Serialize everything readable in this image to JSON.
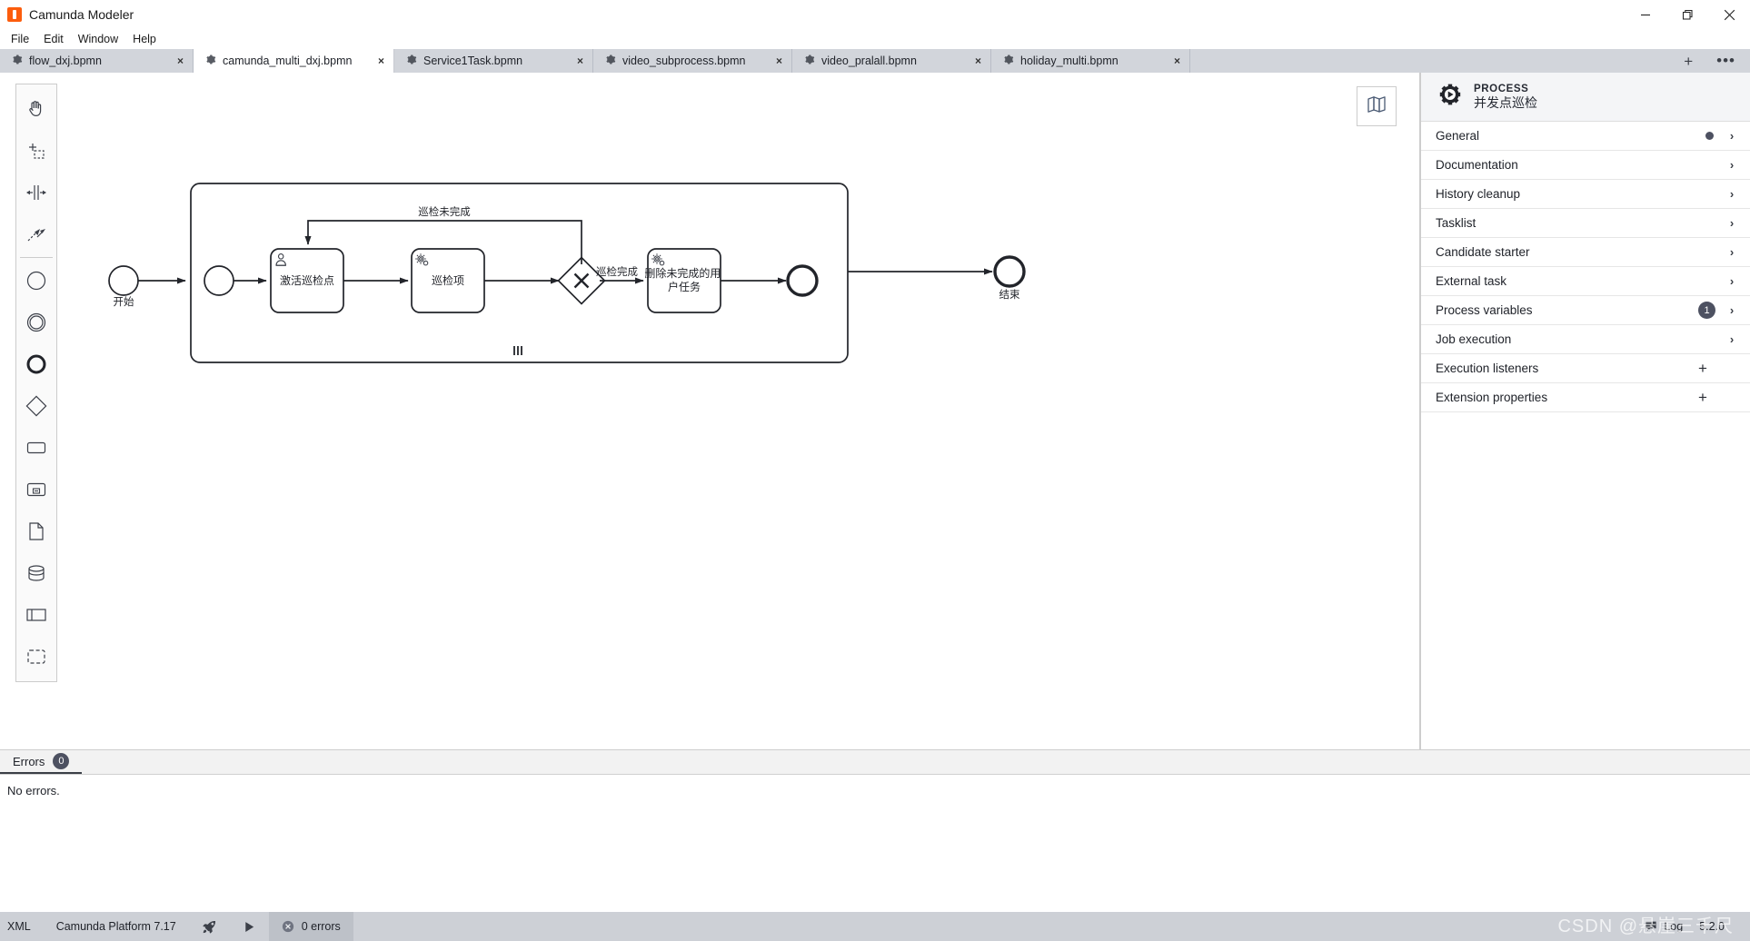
{
  "window": {
    "title": "Camunda Modeler",
    "app_icon": "camunda-icon",
    "minimize": "minimize-icon",
    "maximize": "maximize-icon",
    "close": "close-icon"
  },
  "menu": {
    "items": [
      {
        "label": "File"
      },
      {
        "label": "Edit"
      },
      {
        "label": "Window"
      },
      {
        "label": "Help"
      }
    ]
  },
  "tabs": {
    "items": [
      {
        "label": "flow_dxj.bpmn",
        "active": false,
        "close": "×"
      },
      {
        "label": "camunda_multi_dxj.bpmn",
        "active": true,
        "close": "×"
      },
      {
        "label": "Service1Task.bpmn",
        "active": false,
        "close": "×"
      },
      {
        "label": "video_subprocess.bpmn",
        "active": false,
        "close": "×"
      },
      {
        "label": "video_pralall.bpmn",
        "active": false,
        "close": "×"
      },
      {
        "label": "holiday_multi.bpmn",
        "active": false,
        "close": "×"
      }
    ],
    "new_tab_label": "+",
    "more_label": "•••"
  },
  "palette": {
    "tools": [
      {
        "name": "hand-tool-icon"
      },
      {
        "name": "lasso-tool-icon"
      },
      {
        "name": "space-tool-icon"
      },
      {
        "name": "connect-tool-icon"
      }
    ],
    "elements": [
      {
        "name": "start-event-icon"
      },
      {
        "name": "intermediate-event-icon"
      },
      {
        "name": "end-event-icon"
      },
      {
        "name": "exclusive-gateway-icon"
      },
      {
        "name": "task-icon"
      },
      {
        "name": "subprocess-icon"
      },
      {
        "name": "data-object-icon"
      },
      {
        "name": "data-store-icon"
      },
      {
        "name": "participant-icon"
      },
      {
        "name": "group-icon"
      }
    ]
  },
  "canvas": {
    "minimap_label": "map-icon"
  },
  "diagram": {
    "type": "bpmn",
    "start_event": {
      "label": "开始"
    },
    "end_event": {
      "label": "结束"
    },
    "subprocess": {
      "marker": "parallel-multi-instance",
      "inner_start_event": "",
      "inner_end_event": "",
      "tasks": [
        {
          "id": "t1",
          "label": "激活巡检点",
          "type": "user-task"
        },
        {
          "id": "t2",
          "label": "巡检项",
          "type": "service-task"
        },
        {
          "id": "t3",
          "label": "删除未完成的用户任务",
          "type": "service-task"
        }
      ],
      "gateway": {
        "type": "exclusive",
        "symbol": "✕"
      },
      "flow_labels": [
        {
          "id": "loop",
          "label": "巡检未完成"
        },
        {
          "id": "done",
          "label": "巡检完成"
        }
      ]
    }
  },
  "properties": {
    "header": {
      "kind": "PROCESS",
      "name": "并发点巡检",
      "icon": "process-gear-icon"
    },
    "rows": [
      {
        "label": "General",
        "dot": true,
        "badge": null,
        "action": "chevron"
      },
      {
        "label": "Documentation",
        "dot": false,
        "badge": null,
        "action": "chevron"
      },
      {
        "label": "History cleanup",
        "dot": false,
        "badge": null,
        "action": "chevron"
      },
      {
        "label": "Tasklist",
        "dot": false,
        "badge": null,
        "action": "chevron"
      },
      {
        "label": "Candidate starter",
        "dot": false,
        "badge": null,
        "action": "chevron"
      },
      {
        "label": "External task",
        "dot": false,
        "badge": null,
        "action": "chevron"
      },
      {
        "label": "Process variables",
        "dot": false,
        "badge": "1",
        "action": "chevron"
      },
      {
        "label": "Job execution",
        "dot": false,
        "badge": null,
        "action": "chevron"
      },
      {
        "label": "Execution listeners",
        "dot": false,
        "badge": null,
        "action": "plus"
      },
      {
        "label": "Extension properties",
        "dot": false,
        "badge": null,
        "action": "plus"
      }
    ],
    "chevron_glyph": "›",
    "plus_glyph": "+"
  },
  "errors_panel": {
    "tab_label": "Errors",
    "tab_count": "0",
    "body_text": "No errors."
  },
  "statusbar": {
    "xml_label": "XML",
    "platform_label": "Camunda Platform 7.17",
    "deploy_icon": "rocket-icon",
    "run_icon": "play-icon",
    "errors_icon": "error-circle-icon",
    "errors_label": "0 errors",
    "log_icon": "log-icon",
    "log_label": "Log",
    "version_label": "5.2.0",
    "watermark": "CSDN @悬崖三千尺"
  },
  "colors": {
    "accent_orange": "#fc5d0d",
    "tabbar_bg": "#d2d5db",
    "statusbar_bg": "#cdd0d6",
    "panel_header_bg": "#f4f5f7",
    "badge_bg": "#4d5161",
    "diagram_stroke": "#22242a"
  }
}
